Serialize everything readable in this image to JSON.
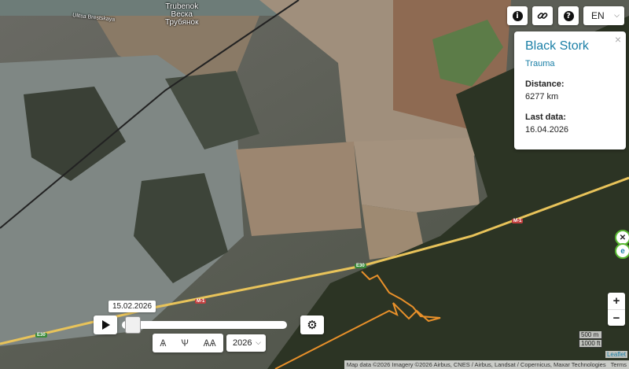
{
  "map": {
    "place_label_lines": [
      "Trubenok",
      "Веска",
      "Трубянок"
    ],
    "street_label": "Ulitsa Brestskaya",
    "road_labels": [
      "M-1",
      "M-1",
      "E30",
      "E30"
    ]
  },
  "toolbar": {
    "info_icon": "info-icon",
    "link_icon": "link-icon",
    "help_icon": "help-icon",
    "language": "EN"
  },
  "panel": {
    "bird_name": "Black Stork",
    "cause": "Trauma",
    "distance_label": "Distance:",
    "distance_value": "6277 km",
    "last_data_label": "Last data:",
    "last_data_value": "16.04.2026"
  },
  "timeline": {
    "date_tooltip": "15.02.2026",
    "year": "2026",
    "progress": 0.02
  },
  "zoom": {
    "in": "+",
    "out": "−"
  },
  "scale": {
    "metric": "500 m",
    "imperial": "1000 ft"
  },
  "attribution": {
    "text": "Map data ©2026 Imagery ©2026 Airbus, CNES / Airbus, Landsat / Copernicus, Maxar Technologies",
    "terms": "Terms",
    "leaflet": "Leaflet"
  },
  "colors": {
    "accent": "#1a7fa6",
    "track": "#e8902a",
    "road": "#e8c35a"
  }
}
